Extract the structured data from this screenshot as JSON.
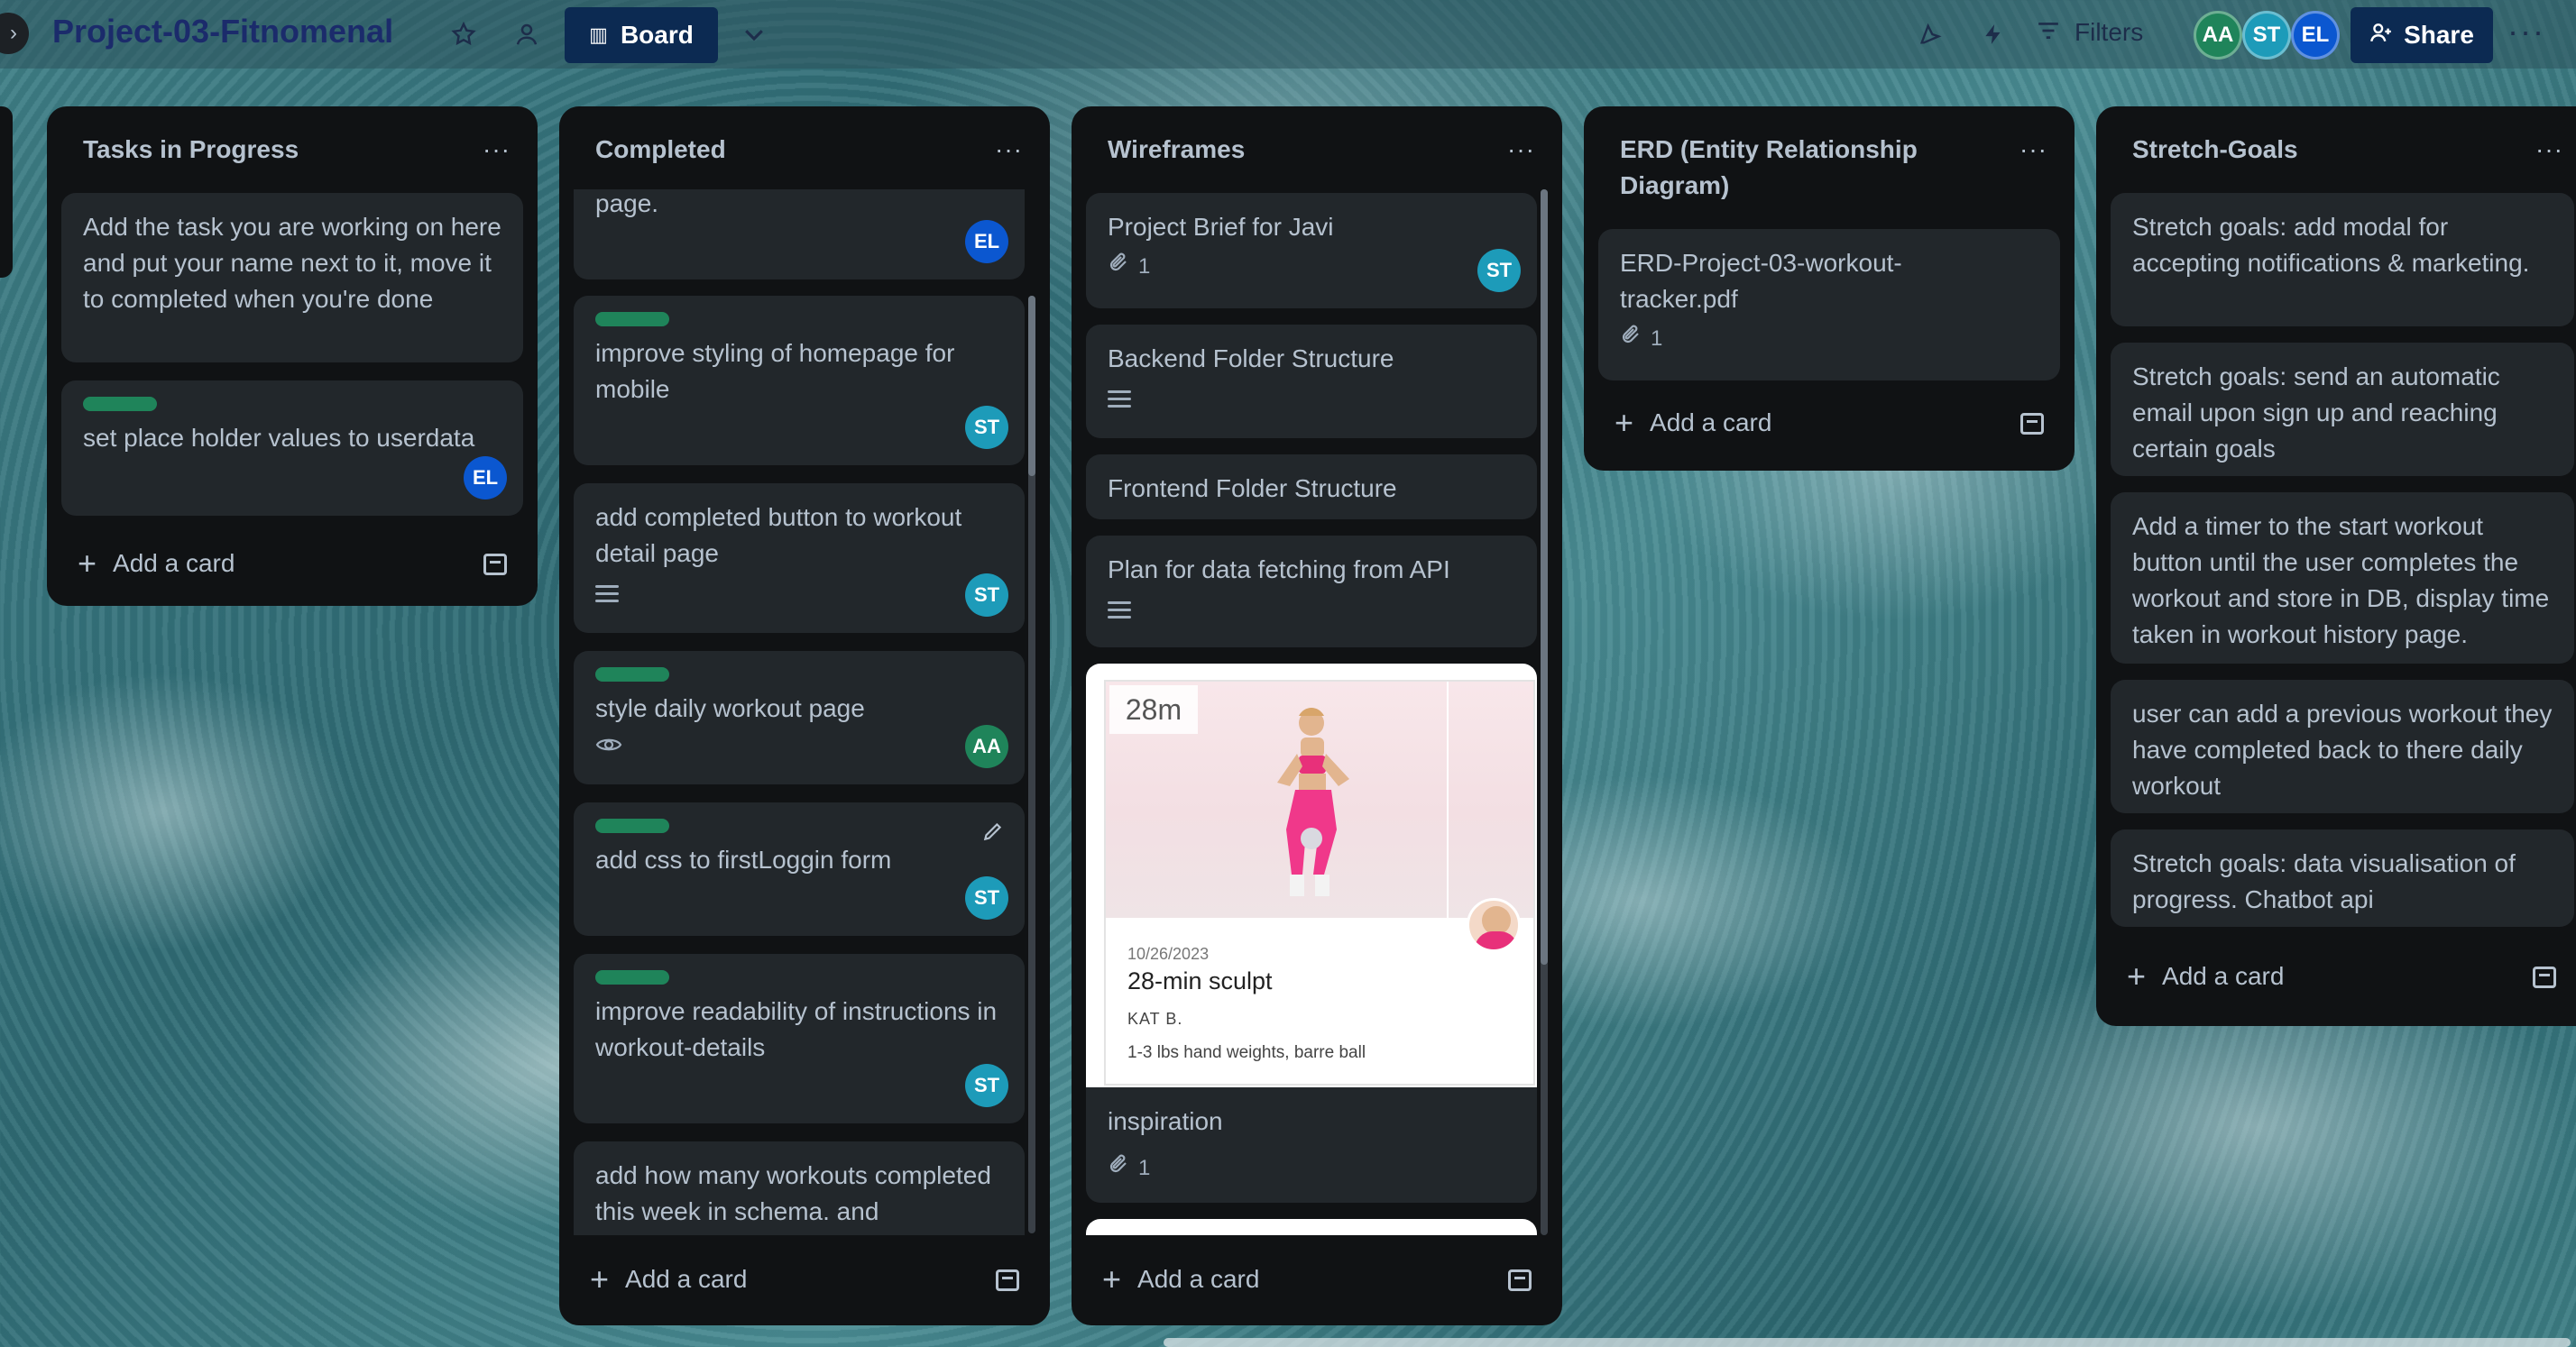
{
  "header": {
    "board_title": "Project-03-Fitnomenal",
    "view_label": "Board",
    "filters_label": "Filters",
    "share_label": "Share",
    "members": [
      {
        "initials": "AA",
        "color": "#1f845a"
      },
      {
        "initials": "ST",
        "color": "#1d9bb9"
      },
      {
        "initials": "EL",
        "color": "#0b57d0"
      }
    ]
  },
  "lists": {
    "tasks_in_progress": {
      "title": "Tasks in Progress",
      "add_card": "Add a card",
      "cards": [
        {
          "text": "Add the task you are working on here and put your name next to it, move it to completed when you're done"
        },
        {
          "text": "set place holder values to userdata",
          "member": "EL",
          "label_color": "#1f845a"
        }
      ]
    },
    "completed": {
      "title": "Completed",
      "add_card": "Add a card",
      "cards": [
        {
          "text": "page.",
          "member": "EL"
        },
        {
          "text": "improve styling of homepage for mobile",
          "member": "ST",
          "label_color": "#1f845a"
        },
        {
          "text": "add completed button to workout detail page",
          "member": "ST"
        },
        {
          "text": "style daily workout page",
          "member": "AA",
          "label_color": "#1f845a"
        },
        {
          "text": "add css to firstLoggin form",
          "member": "ST",
          "label_color": "#1f845a"
        },
        {
          "text": "improve readability of instructions in workout-details",
          "member": "ST",
          "label_color": "#1f845a"
        },
        {
          "text": "add how many workouts completed this week in schema. and functionality"
        }
      ]
    },
    "wireframes": {
      "title": "Wireframes",
      "add_card": "Add a card",
      "cards": [
        {
          "text": "Project Brief for Javi",
          "attachments": "1",
          "member": "ST"
        },
        {
          "text": "Backend Folder Structure"
        },
        {
          "text": "Frontend Folder Structure"
        },
        {
          "text": "Plan for data fetching from API"
        },
        {
          "text": "inspiration",
          "attachments": "1"
        }
      ],
      "cover": {
        "duration": "28m",
        "date": "10/26/2023",
        "title": "28-min sculpt",
        "coach": "KAT B.",
        "equipment": "1-3 lbs hand weights, barre ball"
      }
    },
    "erd": {
      "title": "ERD (Entity Relationship Diagram)",
      "add_card": "Add a card",
      "cards": [
        {
          "text": "ERD-Project-03-workout-tracker.pdf",
          "attachments": "1"
        }
      ]
    },
    "stretch_goals": {
      "title": "Stretch-Goals",
      "add_card": "Add a card",
      "cards": [
        {
          "text": "Stretch goals: add modal for accepting notifications & marketing."
        },
        {
          "text": "Stretch goals: send an automatic email upon sign up and reaching certain goals"
        },
        {
          "text": "Add a timer to the start workout button until the user completes the workout and store in DB, display time taken in workout history page."
        },
        {
          "text": "user can add a previous workout they have completed back to there daily workout"
        },
        {
          "text": "Stretch goals: data visualisation of progress. Chatbot api"
        }
      ]
    }
  }
}
